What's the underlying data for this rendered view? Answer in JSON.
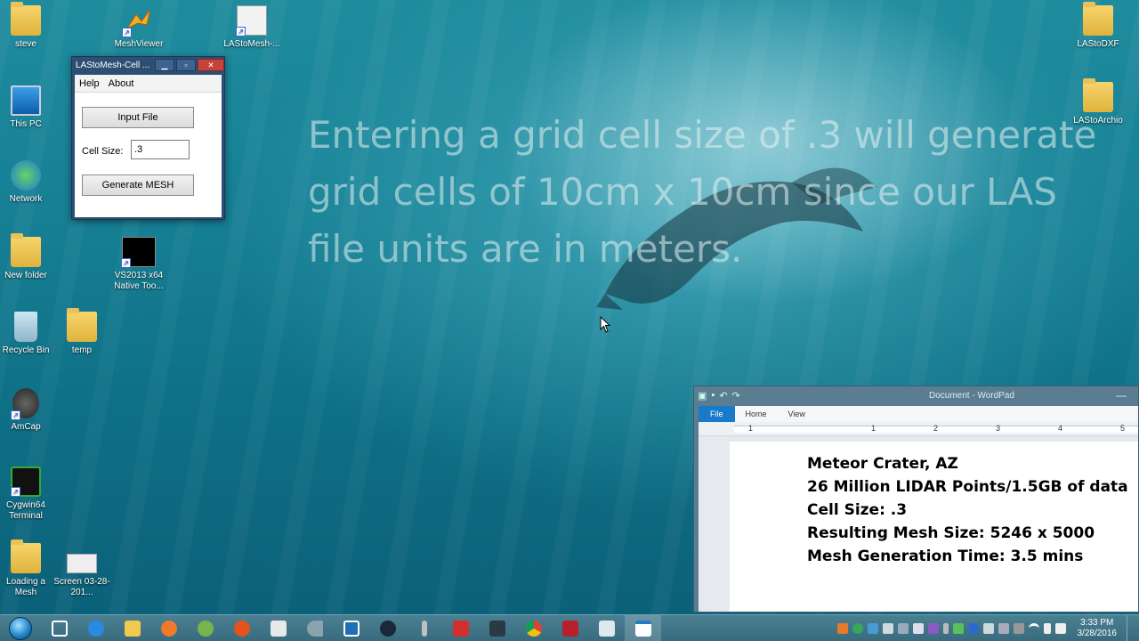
{
  "desktop": {
    "icons": [
      {
        "label": "steve"
      },
      {
        "label": "MeshViewer"
      },
      {
        "label": "LAStoMesh-..."
      },
      {
        "label": "This PC"
      },
      {
        "label": "Network"
      },
      {
        "label": "New folder"
      },
      {
        "label": "VS2013 x64 Native Too..."
      },
      {
        "label": "Recycle Bin"
      },
      {
        "label": "temp"
      },
      {
        "label": "AmCap"
      },
      {
        "label": "Cygwin64 Terminal"
      },
      {
        "label": "Loading a Mesh"
      },
      {
        "label": "Screen 03-28-201..."
      },
      {
        "label": "LAStoDXF"
      },
      {
        "label": "LAStoArchio"
      }
    ]
  },
  "caption": "Entering a grid cell size of .3 will generate\ngrid cells of 10cm x 10cm since our LAS\nfile units are in meters.",
  "app_window": {
    "title": "LAStoMesh-Cell ...",
    "menu": [
      "Help",
      "About"
    ],
    "input_file_label": "Input File",
    "cell_size_label": "Cell Size:",
    "cell_size_value": ".3",
    "generate_label": "Generate MESH"
  },
  "wordpad": {
    "title": "Document - WordPad",
    "tabs": [
      "File",
      "Home",
      "View"
    ],
    "ruler_numbers": [
      "1",
      "1",
      "2",
      "3",
      "4",
      "5"
    ],
    "lines": [
      "Meteor Crater, AZ",
      "26 Million LIDAR Points/1.5GB of data",
      "Cell Size: .3",
      "Resulting Mesh Size: 5246 x 5000",
      "Mesh Generation Time: 3.5 mins"
    ]
  },
  "taskbar": {
    "clock_time": "3:33 PM",
    "clock_date": "3/28/2016"
  }
}
